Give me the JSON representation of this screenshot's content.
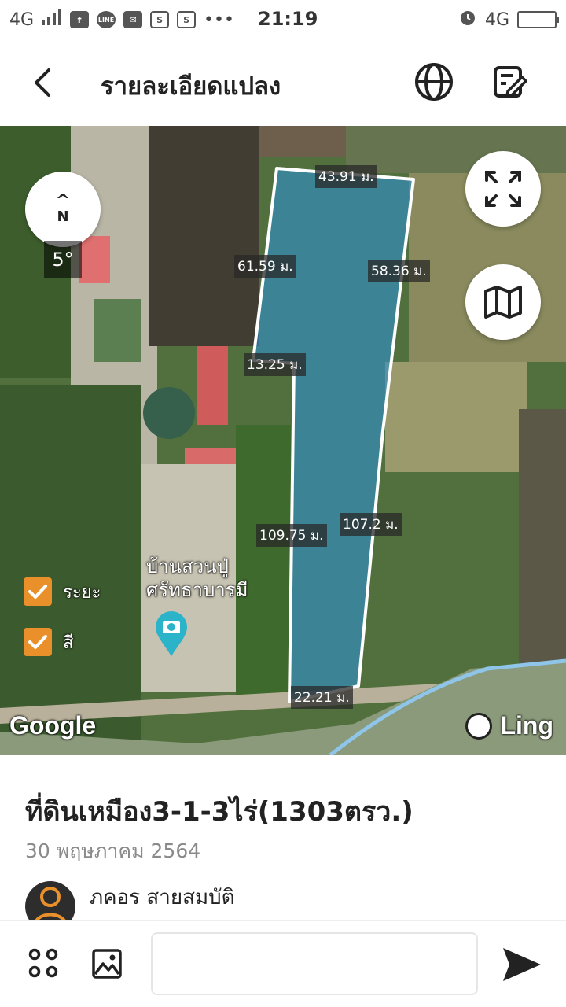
{
  "status_bar": {
    "network": "4G",
    "time": "21:19",
    "right_network": "4G",
    "icons": [
      "signal-icon",
      "facebook-icon",
      "line-icon",
      "mail-icon",
      "s-icon",
      "s-icon",
      "more-icon",
      "alarm-icon",
      "battery-icon"
    ]
  },
  "header": {
    "title": "รายละเอียดแปลง",
    "icons": [
      "back-icon",
      "globe-icon",
      "edit-icon"
    ]
  },
  "map": {
    "compass_letter": "N",
    "bearing": "5°",
    "dimensions": {
      "top": "43.91 ม.",
      "left_upper": "61.59 ม.",
      "right_upper": "58.36 ม.",
      "notch": "13.25 ม.",
      "left_lower": "109.75 ม.",
      "right_lower": "107.2 ม.",
      "bottom": "22.21 ม."
    },
    "checkboxes": [
      {
        "label": "ระยะ",
        "checked": true
      },
      {
        "label": "สี",
        "checked": true
      }
    ],
    "poi_line1": "บ้านสวนปู่",
    "poi_line2": "ศรัทธาบารมี",
    "google_label": "Google",
    "ling_label": "Ling",
    "colors": {
      "parcel_fill": "#2f8fd0",
      "checkbox": "#e9902b",
      "pin": "#2bb3c9"
    }
  },
  "detail": {
    "title": "ที่ดินเหมือง3-1-3ไร่(1303ตรว.)",
    "date": "30 พฤษภาคม 2564",
    "author": "ภคอร สายสมบัติ"
  },
  "bottom_bar": {
    "message_value": "",
    "icons": [
      "apps-icon",
      "image-icon",
      "send-icon"
    ]
  }
}
